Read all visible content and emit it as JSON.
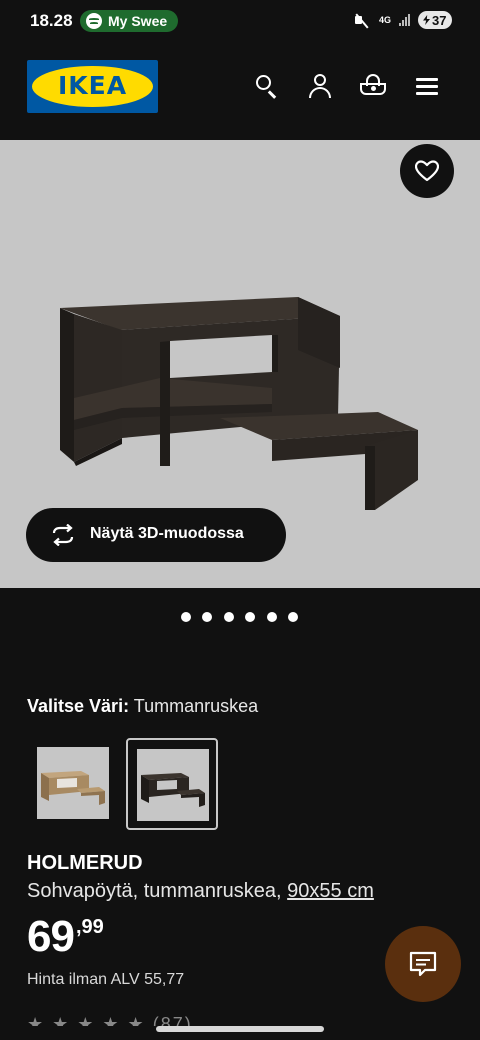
{
  "status_bar": {
    "time": "18.28",
    "media_app": "My Swee",
    "network": "4G",
    "battery": "37"
  },
  "header": {
    "logo_text": "IKEA",
    "logo_colors": {
      "blue": "#0058a3",
      "yellow": "#ffdb00"
    },
    "icons": [
      "search-icon",
      "profile-icon",
      "cart-icon",
      "menu-icon"
    ]
  },
  "media": {
    "background": "#c6c6c6",
    "view_3d_label": "Näytä 3D-muodossa",
    "carousel_count": 6,
    "active_index": 0
  },
  "colour": {
    "label": "Valitse Väri:",
    "value": "Tummanruskea",
    "options": [
      {
        "name": "oak-effect",
        "selected": false,
        "color": "#a0805a"
      },
      {
        "name": "dark-brown",
        "selected": true,
        "color": "#2e2a26"
      }
    ]
  },
  "product": {
    "name": "HOLMERUD",
    "description": "Sohvapöytä, tummanruskea,",
    "dimensions": "90x55 cm",
    "price_integer": "69",
    "price_decimal": ",99",
    "price_ex_vat": "Hinta ilman ALV 55,77",
    "rating_count": "(87)"
  },
  "colors": {
    "page_background": "#111111",
    "chat_button": "#5a2f0e"
  }
}
